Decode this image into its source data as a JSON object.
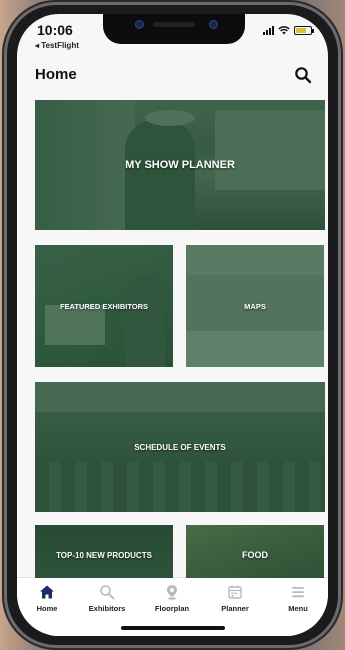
{
  "status_bar": {
    "time": "10:06",
    "back_label": "◂ TestFlight"
  },
  "header": {
    "title": "Home"
  },
  "tiles": {
    "my_show_planner": "MY SHOW PLANNER",
    "featured_exhibitors": "FEATURED EXHIBITORS",
    "maps": "MAPS",
    "schedule_of_events": "SCHEDULE OF EVENTS",
    "top_10_new_products": "TOP-10 NEW PRODUCTS",
    "food": "FOOD"
  },
  "tab_bar": {
    "home": "Home",
    "exhibitors": "Exhibitors",
    "floorplan": "Floorplan",
    "planner": "Planner",
    "menu": "Menu"
  },
  "colors": {
    "tile_overlay": "#2f5a3e",
    "active_tab": "#1f2c6a",
    "inactive_tab": "#b9b9b9"
  }
}
